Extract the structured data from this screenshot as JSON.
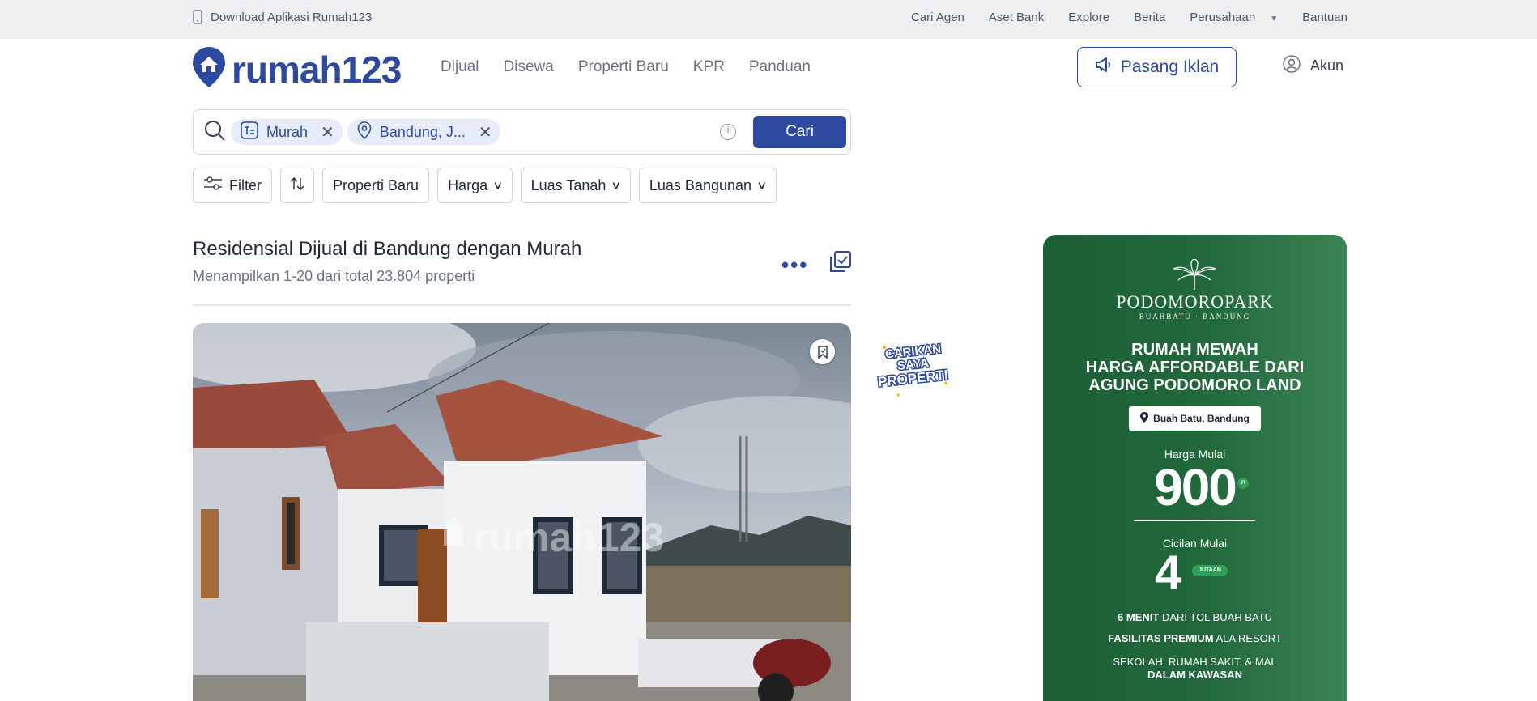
{
  "topbar": {
    "download": "Download Aplikasi Rumah123",
    "links": [
      "Cari Agen",
      "Aset Bank",
      "Explore",
      "Berita",
      "Perusahaan",
      "Bantuan"
    ]
  },
  "header": {
    "logo": "rumah123",
    "nav": [
      "Dijual",
      "Disewa",
      "Properti Baru",
      "KPR",
      "Panduan"
    ],
    "pasang_iklan": "Pasang Iklan",
    "akun": "Akun"
  },
  "search": {
    "chips": [
      {
        "label": "Murah",
        "icon": "keyword-icon"
      },
      {
        "label": "Bandung, J...",
        "icon": "location-pin-icon"
      }
    ],
    "button": "Cari"
  },
  "filters": {
    "filter": "Filter",
    "properti_baru": "Properti Baru",
    "harga": "Harga",
    "luas_tanah": "Luas Tanah",
    "luas_bangunan": "Luas Bangunan"
  },
  "listing": {
    "title": "Residensial Dijual di Bandung dengan Murah",
    "summary": "Menampilkan 1-20 dari total 23.804 properti",
    "watermark": "rumah123"
  },
  "sticker": {
    "lines": [
      "CARIKAN",
      "SAYA",
      "PROPERTI"
    ]
  },
  "ad": {
    "brand": "PODOMOROPARK",
    "brand_sub": "BUAHBATU · BANDUNG",
    "headline": [
      "RUMAH MEWAH",
      "HARGA AFFORDABLE DARI",
      "AGUNG PODOMORO LAND"
    ],
    "location": "Buah Batu, Bandung",
    "harga_label": "Harga Mulai",
    "harga_value": "900",
    "harga_unit": "JT",
    "cicilan_label": "Cicilan Mulai",
    "cicilan_value": "4",
    "cicilan_unit": "JUTAAN",
    "feature1_bold": "6 MENIT",
    "feature1_rest": " DARI TOL BUAH BATU",
    "feature2_bold": "FASILITAS PREMIUM",
    "feature2_rest": " ALA RESORT",
    "feature3": "SEKOLAH, RUMAH SAKIT, & MAL",
    "feature4": "DALAM KAWASAN"
  },
  "colors": {
    "brand_blue": "#2e4aa0",
    "chip_bg": "#e6ecfa",
    "ad_green": "#22693d"
  }
}
